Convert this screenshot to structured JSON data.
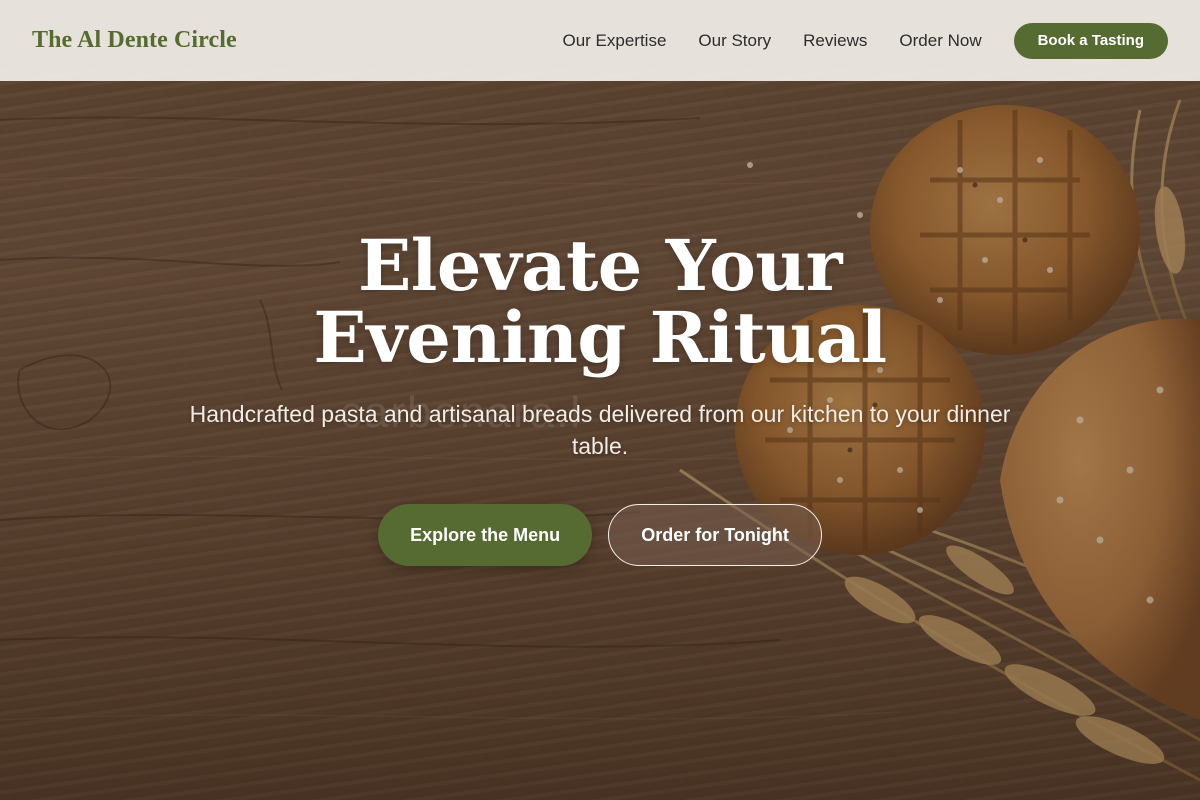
{
  "header": {
    "brand": "The Al Dente Circle",
    "nav": [
      "Our Expertise",
      "Our Story",
      "Reviews",
      "Order Now"
    ],
    "cta": "Book a Tasting"
  },
  "hero": {
    "title": "Elevate Your Evening Ritual",
    "subtitle": "Handcrafted pasta and artisanal breads delivered from our kitchen to your dinner table.",
    "primary_action": "Explore the Menu",
    "secondary_action": "Order for Tonight",
    "background_image": "wood-table-bread-wheat-photo"
  },
  "watermark": "carbonara.l",
  "colors": {
    "brand_green": "#566b31",
    "header_bg": "#ece8e2",
    "nav_text": "#2d2d2d",
    "hero_text": "#ffffff"
  }
}
